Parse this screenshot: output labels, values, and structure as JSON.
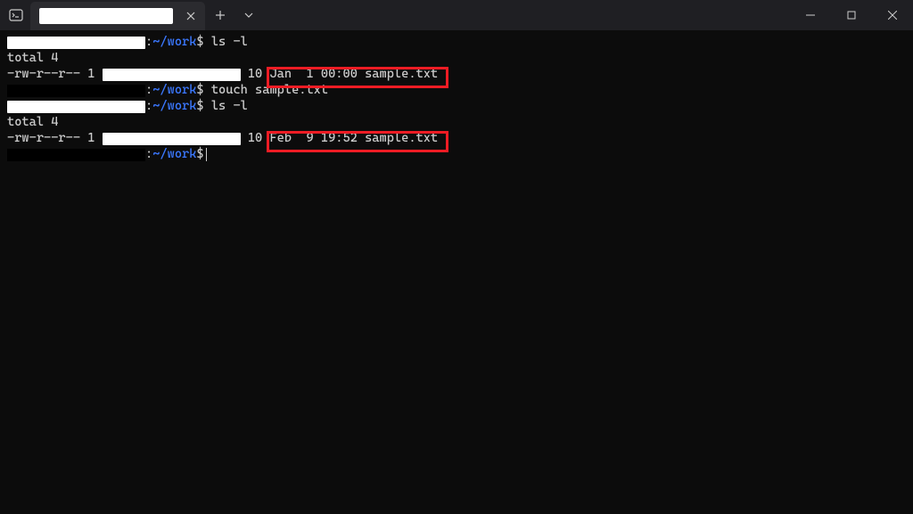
{
  "titlebar": {
    "close_tab_tooltip": "Close tab",
    "new_tab_tooltip": "New tab",
    "dropdown_tooltip": "Open a new tab dropdown",
    "minimize_tooltip": "Minimize",
    "maximize_tooltip": "Maximize",
    "close_tooltip": "Close"
  },
  "terminal": {
    "prompt_sep": ":",
    "prompt_path": "~/work",
    "prompt_symbol": "$",
    "lines": {
      "cmd1": "ls -l",
      "total1": "total 4",
      "perm1": "-rw-r--r-- 1 ",
      "size1": " 10 ",
      "date1_a": "Jan  1 00:00 sample",
      "date1_b": ".txt",
      "cmd2": "touch sample.txt",
      "cmd3": "ls -l",
      "total2": "total 4",
      "perm2": "-rw-r--r-- 1 ",
      "size2": " 10 ",
      "date2_a": "Feb  9 19:52 sample",
      "date2_b": ".txt"
    }
  }
}
